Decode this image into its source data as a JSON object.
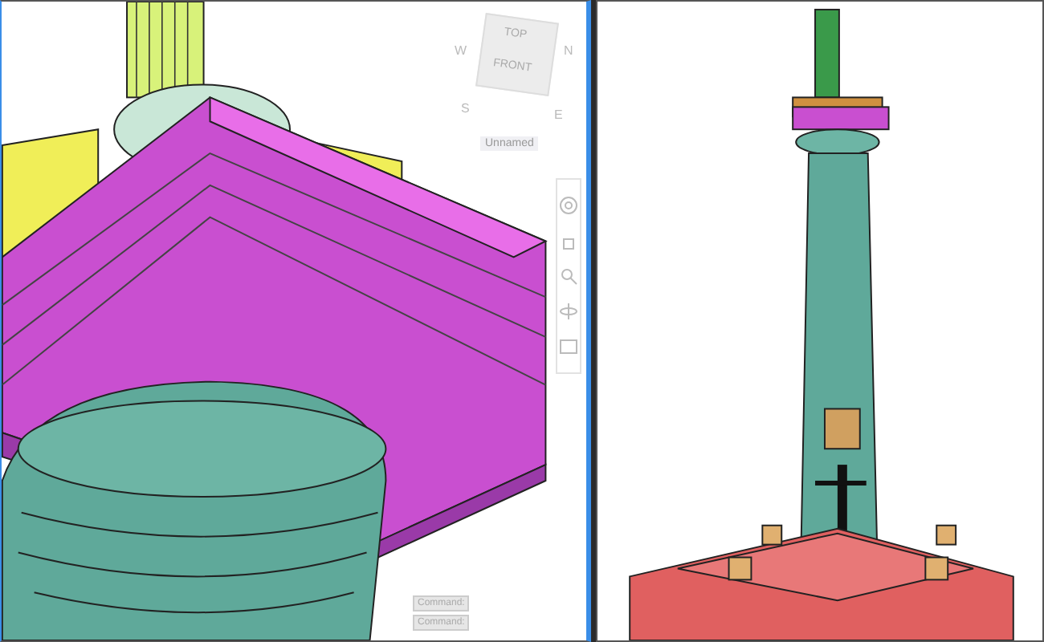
{
  "viewports": [
    {
      "selected": true,
      "viewcube": {
        "top": "TOP",
        "front": "FRONT",
        "compass": [
          "W",
          "N",
          "S",
          "E"
        ]
      },
      "view_menu": "Unnamed",
      "command_history": [
        "Command:",
        "Command:"
      ]
    },
    {
      "selected": false
    }
  ]
}
